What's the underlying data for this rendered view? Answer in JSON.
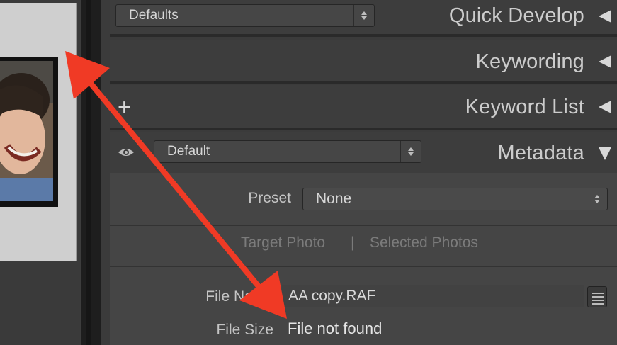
{
  "quick_develop": {
    "preset_value": "Defaults",
    "title": "Quick Develop"
  },
  "keywording": {
    "title": "Keywording"
  },
  "keyword_list": {
    "title": "Keyword List",
    "add_symbol": "+"
  },
  "metadata": {
    "title": "Metadata",
    "view_value": "Default",
    "preset_label": "Preset",
    "preset_value": "None",
    "target_photo": "Target Photo",
    "separator": "|",
    "selected_photos": "Selected Photos",
    "fields": [
      {
        "label": "File Name",
        "value": "AA copy.RAF"
      },
      {
        "label": "File Size",
        "value": "File not found"
      }
    ]
  },
  "colors": {
    "annotation_arrow": "#f03a25",
    "panel_bg": "#3b3b3b"
  },
  "icons": [
    "eye-icon",
    "plus-icon",
    "list-icon",
    "collapse-triangle-icon",
    "expand-triangle-icon"
  ]
}
